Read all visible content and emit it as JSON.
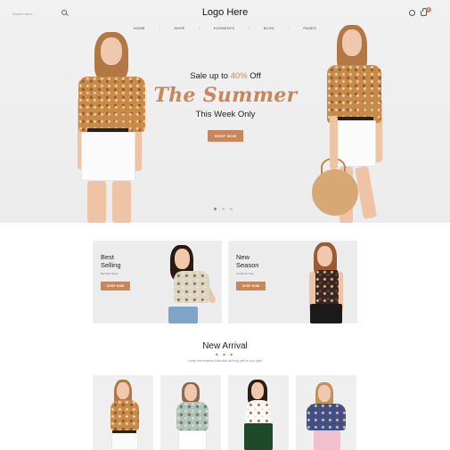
{
  "header": {
    "search_placeholder": "Search here...",
    "logo": "Logo Here",
    "nav": [
      "HOME",
      "SHOP",
      "ELEMENTS",
      "BLOG",
      "PAGES"
    ],
    "cart_count": "0"
  },
  "hero": {
    "sale_prefix": "Sale up to ",
    "sale_pct": "40%",
    "sale_suffix": " Off",
    "headline": "The Summer",
    "subline": "This Week Only",
    "cta": "SHOP NOW",
    "slides": 3,
    "active_slide": 1
  },
  "banners": [
    {
      "title_line1": "Best",
      "title_line2": "Selling",
      "sub": "Big Sale Week",
      "cta": "SHOP NOW"
    },
    {
      "title_line1": "New",
      "title_line2": "Season",
      "sub": "Lookbook Now",
      "cta": "SHOP NOW"
    }
  ],
  "new_arrival": {
    "title": "New Arrival",
    "deco": "◆ ◆ ◆",
    "subtitle": "Hurry, the freshest collection arriving just for you right"
  },
  "colors": {
    "accent": "#c7875a",
    "hero_bg": "#ededed"
  }
}
